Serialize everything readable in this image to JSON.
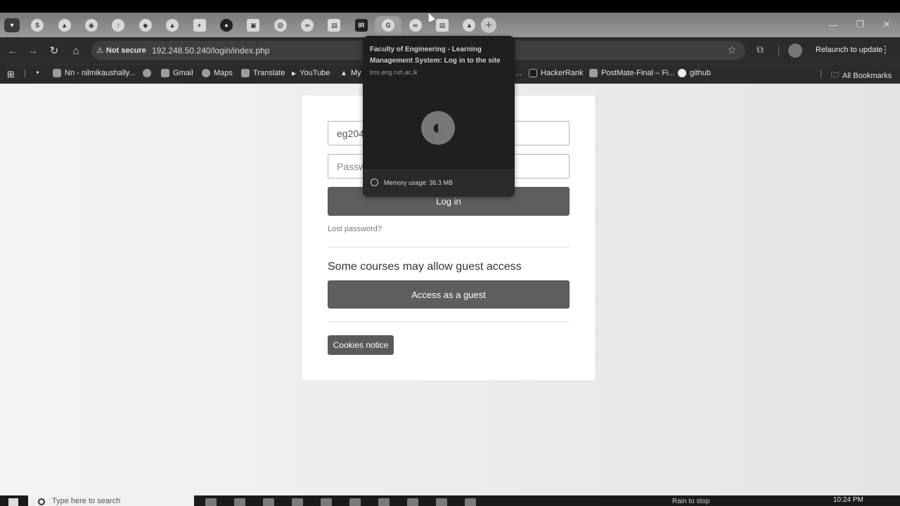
{
  "browser": {
    "tab_favicons": [
      "s-icon",
      "drive-icon",
      "circle-icon",
      "up-arrow-icon",
      "moodle-icon",
      "drive-icon",
      "plus-box-icon",
      "github-icon",
      "window-icon",
      "swirl-icon",
      "infinity-icon",
      "doc-icon",
      "ir-icon",
      "moodle-active-icon",
      "infinity-icon",
      "doc-icon",
      "drive-icon"
    ],
    "security_label": "Not secure",
    "url": "192.248.50.240/login/index.php",
    "relaunch_label": "Relaunch to update"
  },
  "bookmarks": {
    "items": [
      {
        "label": "Nn - nilmikaushally..."
      },
      {
        "label": ""
      },
      {
        "label": "Gmail"
      },
      {
        "label": "Maps"
      },
      {
        "label": "Translate"
      },
      {
        "label": "YouTube"
      },
      {
        "label": "My"
      },
      {
        "label": "..."
      },
      {
        "label": "HackerRank"
      },
      {
        "label": "PostMate-Final – Fi..."
      },
      {
        "label": "github"
      }
    ],
    "all_label": "All Bookmarks"
  },
  "hover_card": {
    "title": "Faculty of Engineering - Learning Management System: Log in to the site",
    "domain": "lms.eng.ruh.ac.lk",
    "memory": "Memory usage: 36.3 MB"
  },
  "login": {
    "username_value": "eg204",
    "password_placeholder": "Password",
    "login_button": "Log in",
    "lost_password": "Lost password?",
    "guest_heading": "Some courses may allow guest access",
    "guest_button": "Access as a guest",
    "cookies_button": "Cookies notice"
  },
  "taskbar": {
    "search_placeholder": "Type here to search",
    "tray_text": "Rain to stop",
    "time": "10:24 PM"
  }
}
